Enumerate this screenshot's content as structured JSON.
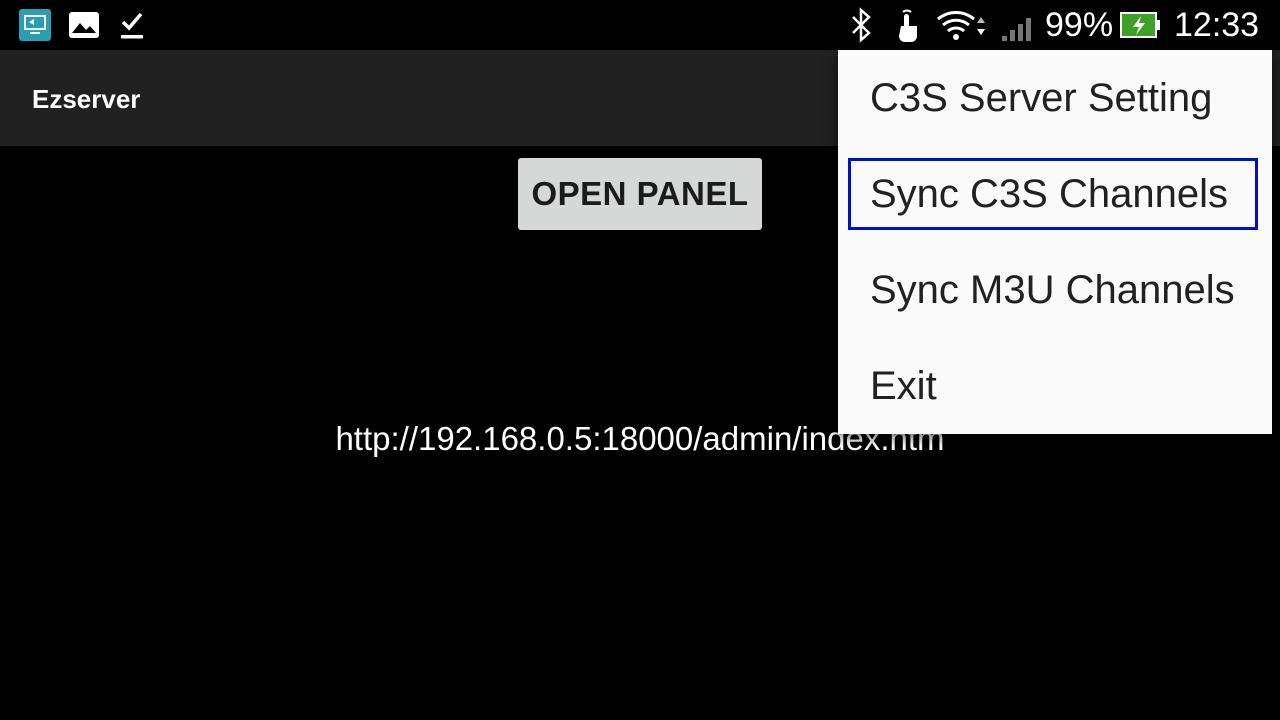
{
  "status_bar": {
    "left_icons": [
      "remote-desktop-icon",
      "image-icon",
      "download-done-icon"
    ],
    "right_icons": [
      "bluetooth-icon",
      "touch-icon",
      "wifi-icon",
      "signal-icon",
      "battery-charging-icon"
    ],
    "battery_percent": "99%",
    "time": "12:33"
  },
  "app_bar": {
    "title": "Ezserver"
  },
  "main": {
    "open_panel_label": "OPEN PANEL",
    "url": "http://192.168.0.5:18000/admin/index.htm"
  },
  "overflow_menu": {
    "items": [
      {
        "label": "C3S Server Setting"
      },
      {
        "label": "Sync C3S Channels"
      },
      {
        "label": "Sync M3U Channels"
      },
      {
        "label": "Exit"
      }
    ],
    "highlight_color": "#0010c8"
  }
}
